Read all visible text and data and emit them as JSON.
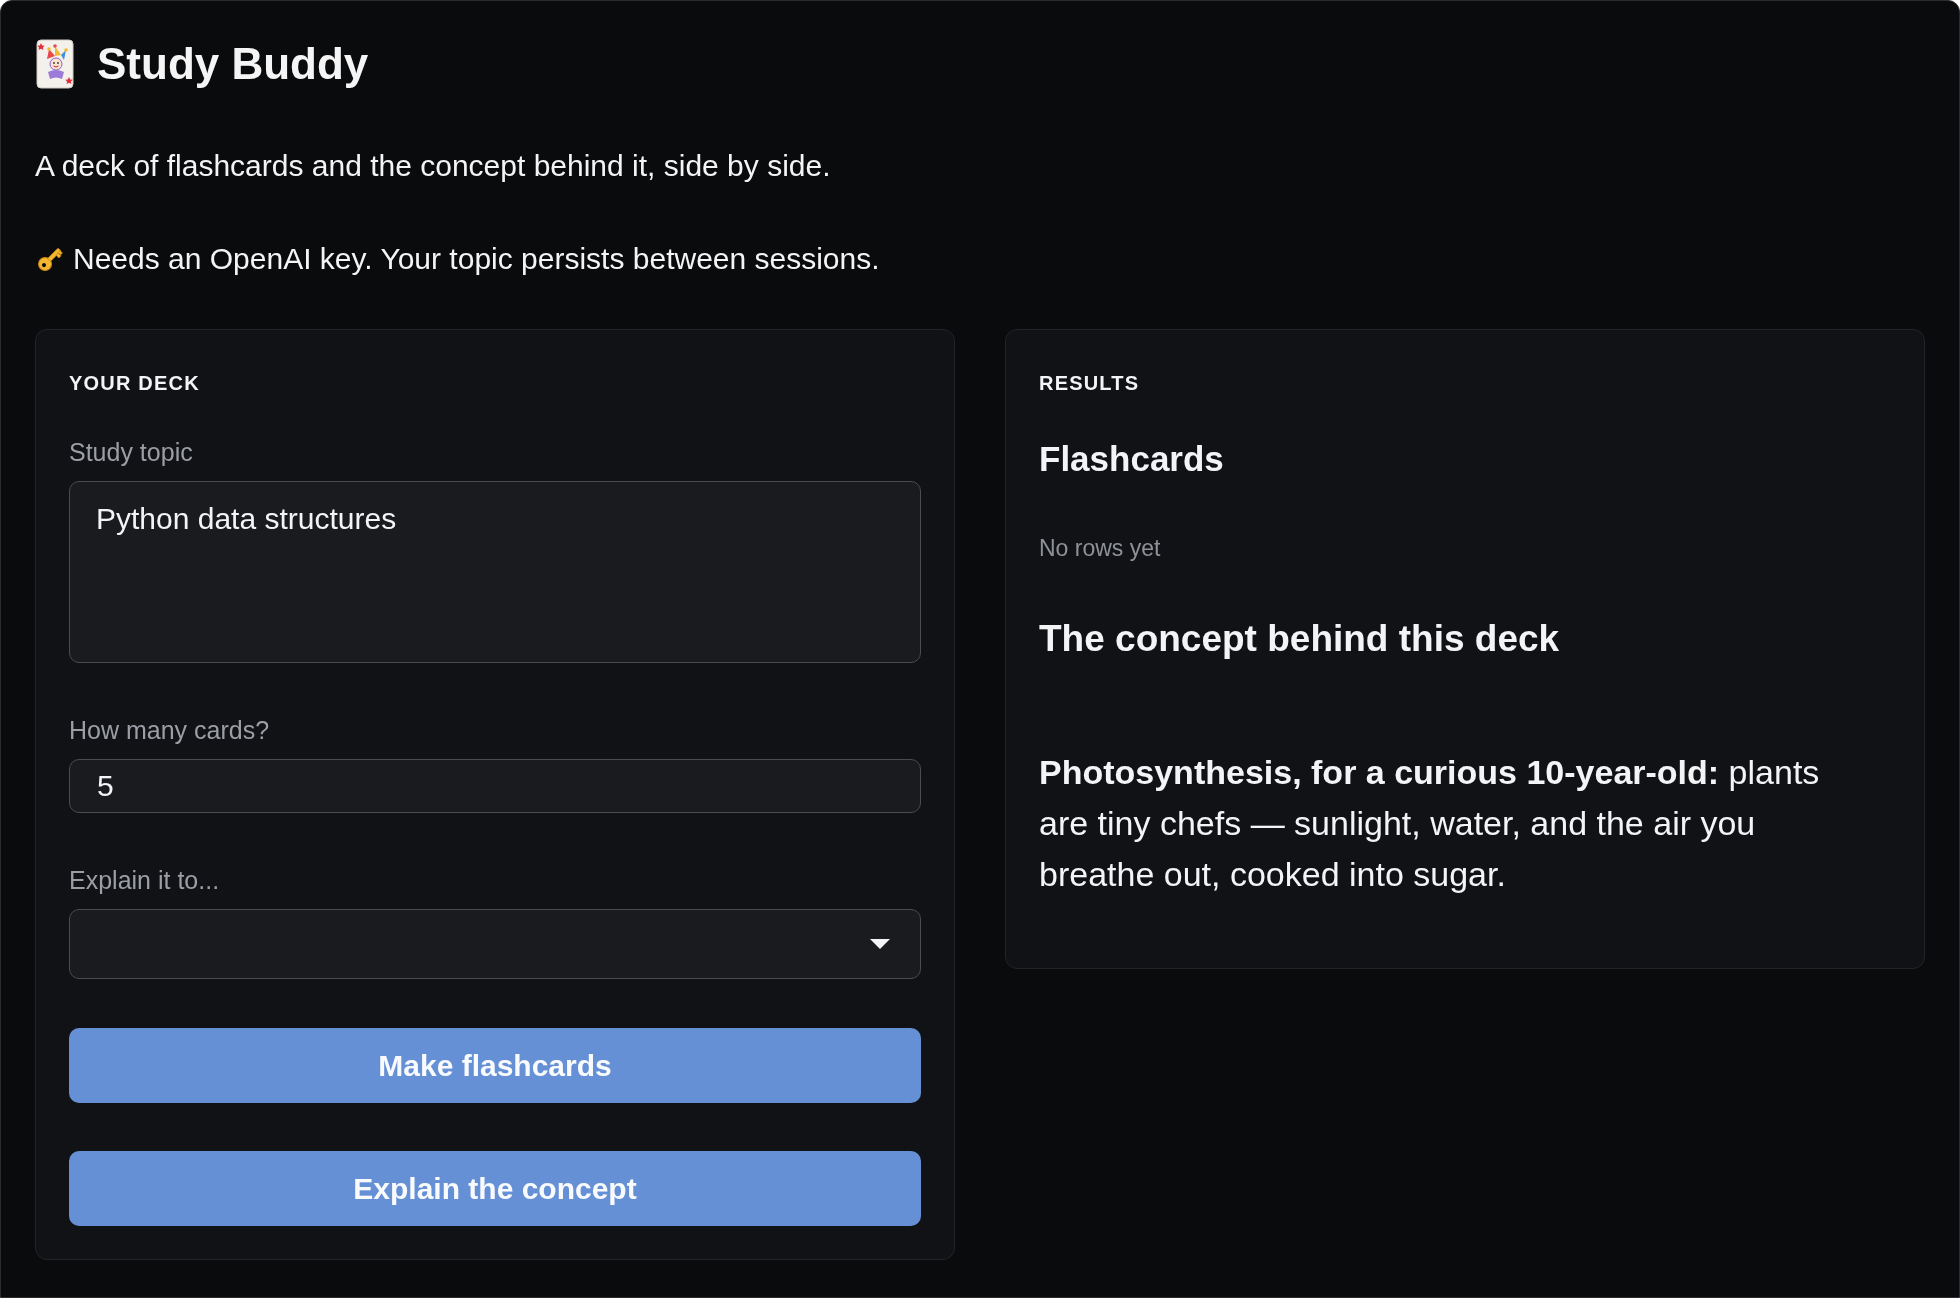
{
  "app": {
    "title": "Study Buddy",
    "subtitle": "A deck of flashcards and the concept behind it, side by side.",
    "note": "Needs an OpenAI key. Your topic persists between sessions."
  },
  "deck_panel": {
    "heading": "YOUR DECK",
    "fields": [
      {
        "kind": "textarea",
        "label": "Study topic",
        "value": "Python data structures"
      },
      {
        "kind": "number",
        "label": "How many cards?",
        "value": "5"
      },
      {
        "kind": "select",
        "label": "Explain it to..."
      }
    ],
    "buttons": [
      "Make flashcards",
      "Explain the concept"
    ]
  },
  "results_panel": {
    "heading": "RESULTS",
    "sections": [
      {
        "kind": "table",
        "title": "Flashcards",
        "empty_text": "No rows yet"
      },
      {
        "kind": "markdown",
        "title": "The concept behind this deck",
        "text": "**Photosynthesis, for a curious 10-year-old:** plants are tiny chefs — sunlight, water, and the air you breathe out, cooked into sugar."
      }
    ]
  }
}
